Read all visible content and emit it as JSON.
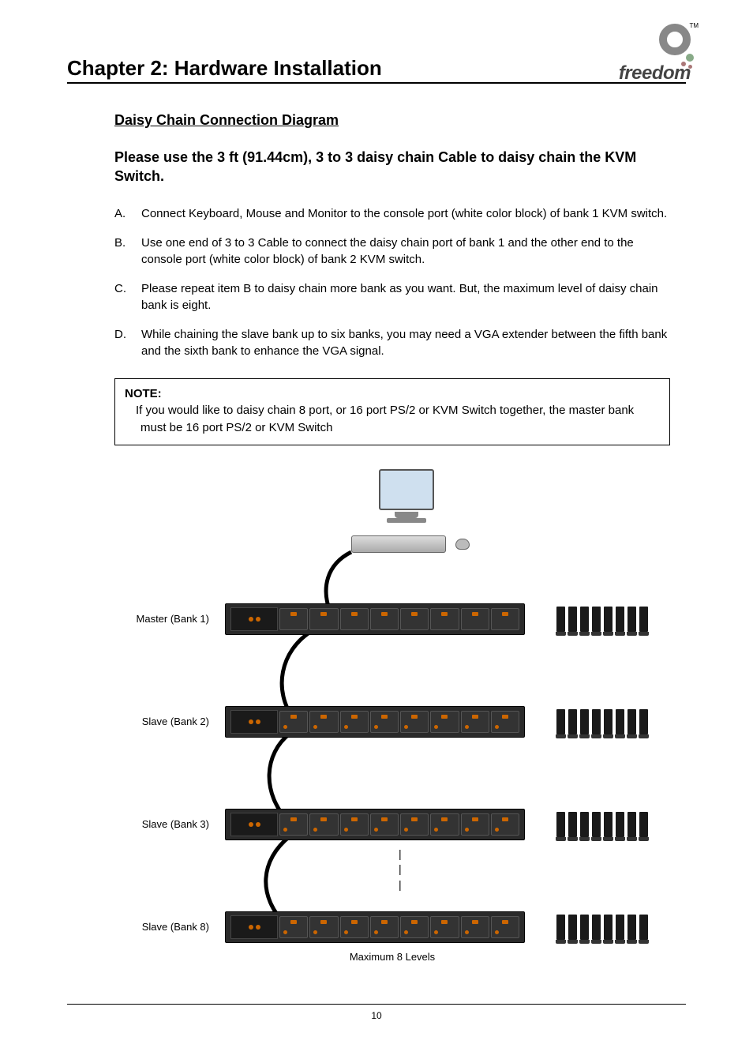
{
  "header": {
    "chapter_title": "Chapter 2: Hardware Installation",
    "logo_text": "freedom",
    "logo_tm": "TM"
  },
  "section": {
    "heading": "Daisy Chain Connection Diagram",
    "intro": "Please use the 3 ft (91.44cm), 3 to 3 daisy chain Cable to daisy chain the KVM Switch.",
    "items": [
      {
        "marker": "A.",
        "text": "Connect Keyboard, Mouse and Monitor to the console port (white color block) of bank 1 KVM switch."
      },
      {
        "marker": "B.",
        "text": "Use one end of 3 to 3 Cable to connect the daisy chain port of bank 1 and the other end to the console port (white color block) of bank 2 KVM switch."
      },
      {
        "marker": "C.",
        "text": "Please repeat item B to daisy chain more bank as you want. But, the maximum level of daisy chain bank is eight."
      },
      {
        "marker": "D.",
        "text": "While chaining the slave bank up to six banks, you may need a VGA extender between the fifth bank and the sixth bank to enhance the VGA signal."
      }
    ]
  },
  "note": {
    "label": "NOTE:",
    "body": "If you would like to daisy chain 8 port, or 16 port PS/2 or KVM Switch together, the master bank must be 16 port PS/2 or KVM Switch"
  },
  "diagram": {
    "banks": [
      {
        "label": "Master (Bank 1)"
      },
      {
        "label": "Slave (Bank 2)"
      },
      {
        "label": "Slave (Bank 3)"
      },
      {
        "label": "Slave (Bank 8)"
      }
    ],
    "vdots": "|\n|\n|",
    "caption": "Maximum 8 Levels"
  },
  "footer": {
    "page": "10"
  }
}
